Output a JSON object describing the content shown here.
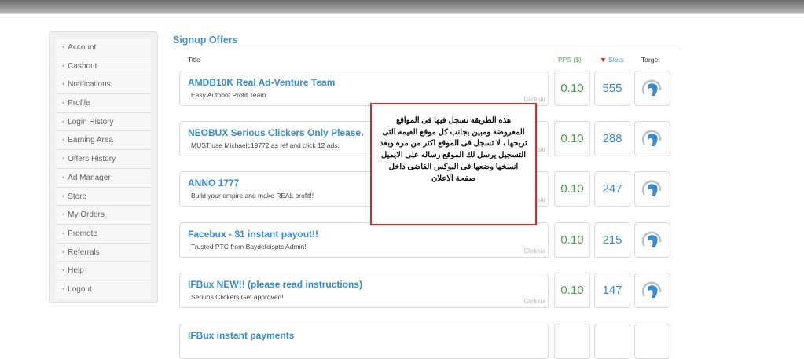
{
  "sidebar": {
    "items": [
      {
        "label": "Account"
      },
      {
        "label": "Cashout"
      },
      {
        "label": "Notifications"
      },
      {
        "label": "Profile"
      },
      {
        "label": "Login History"
      },
      {
        "label": "Earning Area"
      },
      {
        "label": "Offers History"
      },
      {
        "label": "Ad Manager"
      },
      {
        "label": "Store"
      },
      {
        "label": "My Orders"
      },
      {
        "label": "Promote"
      },
      {
        "label": "Referrals"
      },
      {
        "label": "Help"
      },
      {
        "label": "Logout"
      }
    ]
  },
  "offers": {
    "heading": "Signup Offers",
    "columns": {
      "title": "Title",
      "pps": "PPS ($)",
      "slots": "Slots",
      "target": "Target"
    },
    "rows": [
      {
        "title": "AMDB10K Real Ad-Venture Team",
        "desc": "Easy Autobot Profit Team",
        "source": "Clicksia",
        "pps": "0.10",
        "slots": "555"
      },
      {
        "title": "NEOBUX Serious Clickers Only Please.",
        "desc": "MUST use Michaelc19772 as ref and click 12 ads.",
        "source": "Clicksia",
        "pps": "0.10",
        "slots": "288"
      },
      {
        "title": "ANNO 1777",
        "desc": "Build your empire and make REAL profit!!",
        "source": "Clicksia",
        "pps": "0.10",
        "slots": "247"
      },
      {
        "title": "Facebux - $1 instant payout!!",
        "desc": "Trusted PTC from Baydefeisptc Admin!",
        "source": "Clicksia",
        "pps": "0.10",
        "slots": "215"
      },
      {
        "title": "IFBux NEW!! (please read instructions)",
        "desc": "Seriuos Clickers Get approved!",
        "source": "Clicksia",
        "pps": "0.10",
        "slots": "147"
      },
      {
        "title": "IFBux instant payments",
        "desc": "",
        "source": "",
        "pps": "",
        "slots": ""
      }
    ]
  },
  "note": {
    "text": "هذه الطريقه تسجل فيها فى المواقع المعروضه ومبين بجانب كل موقع القيمه التى تربحها ، لا تسجل فى الموقع اكثر من مره وبعد التسجيل يرسل لك الموقع رساله على الايميل انسخها وضعها فى البوكس الفاضى داخل صفحة الاعلان"
  },
  "colors": {
    "accent": "#3a8ccc",
    "pps": "#4a9f4a",
    "note_border": "#c83232"
  },
  "icons": {
    "target": "target-logo-icon",
    "slots_sort": "sort-down-icon"
  }
}
